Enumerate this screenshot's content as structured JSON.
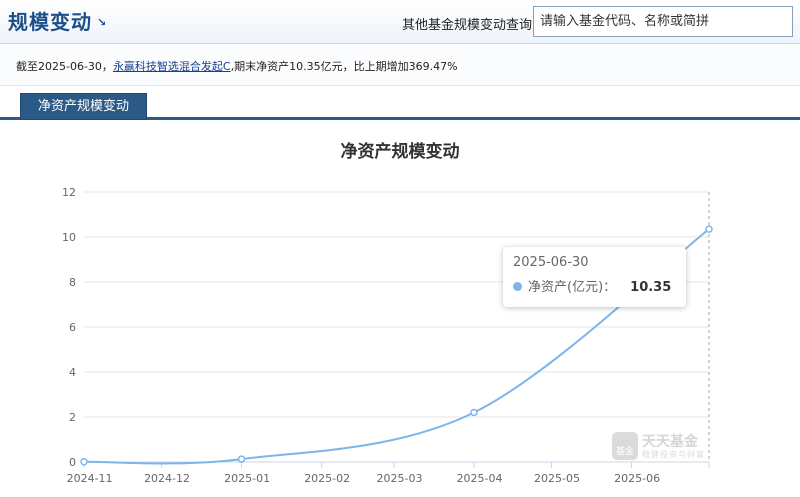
{
  "header": {
    "title": "规模变动",
    "title_icon": "↘",
    "query_label": "其他基金规模变动查询:",
    "search_placeholder": "请输入基金代码、名称或简拼"
  },
  "info": {
    "prefix": "截至2025-06-30，",
    "fund_link": "永赢科技智选混合发起C",
    "suffix": ",期末净资产10.35亿元，比上期增加369.47%"
  },
  "tabs": [
    {
      "label": "净资产规模变动",
      "active": true
    }
  ],
  "chart_data": {
    "type": "line",
    "title": "净资产规模变动",
    "x_tick_labels": [
      "2024-11",
      "2024-12",
      "2025-01",
      "2025-02",
      "2025-03",
      "2025-04",
      "2025-05",
      "2025-06"
    ],
    "ylim": [
      0,
      12
    ],
    "y_ticks": [
      0,
      2,
      4,
      6,
      8,
      10,
      12
    ],
    "series": [
      {
        "name": "净资产(亿元)",
        "color": "#7cb5ec",
        "points": [
          {
            "x": "2024-10-31",
            "y": 0.01
          },
          {
            "x": "2024-12-31",
            "y": 0.13
          },
          {
            "x": "2025-03-31",
            "y": 2.2
          },
          {
            "x": "2025-06-30",
            "y": 10.35
          }
        ]
      }
    ],
    "grid": true,
    "tooltip": {
      "date": "2025-06-30",
      "label": "净资产(亿元)：",
      "value": "10.35"
    }
  },
  "watermark": {
    "name": "天天基金",
    "sub": "稳健投资与财富",
    "logo_text": "基金"
  }
}
